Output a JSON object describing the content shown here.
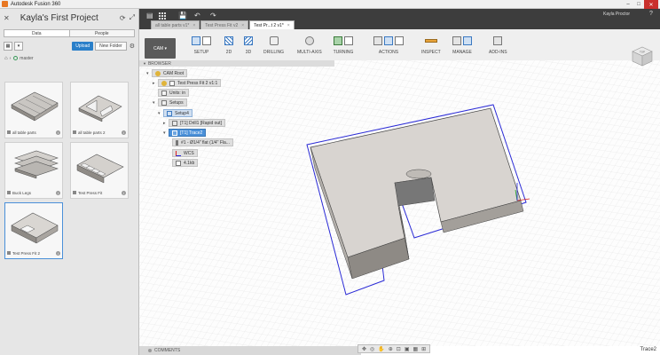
{
  "window": {
    "title": "Autodesk Fusion 360"
  },
  "data_panel": {
    "project_title": "Kayla's First Project",
    "tabs": [
      "Data",
      "People"
    ],
    "upload_label": "Upload",
    "new_folder_label": "New Folder",
    "breadcrumb": "master",
    "thumbnails": [
      {
        "label": "all table parts"
      },
      {
        "label": "all table parts 2"
      },
      {
        "label": "Buck Legs"
      },
      {
        "label": "Test Press Fit"
      },
      {
        "label": "Test Press Fit 2"
      }
    ]
  },
  "doc_tabs": [
    {
      "label": "all table parts v1*"
    },
    {
      "label": "Test Press Fit v2"
    },
    {
      "label": "Test Pr...t 2 v1*"
    }
  ],
  "user": {
    "name": "Kayla Proctor"
  },
  "ribbon": {
    "workspace": "CAM",
    "groups": [
      "SETUP",
      "2D",
      "3D",
      "DRILLING",
      "MULTI-AXIS",
      "TURNING",
      "ACTIONS",
      "INSPECT",
      "MANAGE",
      "ADD-INS"
    ]
  },
  "browser": {
    "header": "BROWSER",
    "nodes": [
      {
        "label": "CAM Root"
      },
      {
        "label": "Test Press Fit 2 v1:1"
      },
      {
        "label": "Units: in"
      },
      {
        "label": "Setups"
      },
      {
        "label": "Setup4"
      },
      {
        "label": "[T1] Drill1 [Rapid out]"
      },
      {
        "label": "[T1] Trace2"
      },
      {
        "label": "#1 - Ø1/4\" flat (1/4\" Fla..."
      },
      {
        "label": "WCS"
      },
      {
        "label": "4.1kb"
      }
    ]
  },
  "viewcube": {
    "face_label": "TOP"
  },
  "comments": {
    "label": "COMMENTS"
  },
  "status": {
    "text": "Trace2"
  }
}
